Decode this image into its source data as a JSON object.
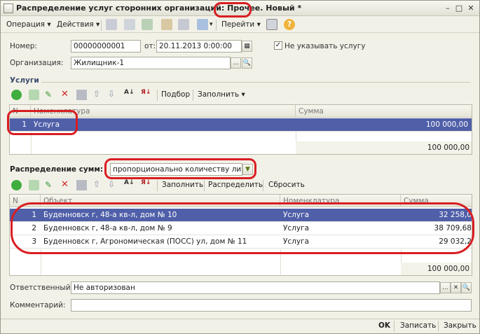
{
  "window": {
    "title": "Распределение услуг сторонних организаций: Прочее. Новый *"
  },
  "toolbar": {
    "operation": "Операция",
    "actions": "Действия",
    "goto": "Перейти",
    "help": "?"
  },
  "form": {
    "number_label": "Номер:",
    "number_value": "00000000001",
    "from_label": "от:",
    "date_value": "20.11.2013  0:00:00",
    "checkbox_label": "Не указывать услугу",
    "org_label": "Организация:",
    "org_value": "Жилищник-1"
  },
  "services": {
    "title": "Услуги",
    "pick_label": "Подбор",
    "fill_label": "Заполнить",
    "columns": [
      "N",
      "Номенклатура",
      "Сумма"
    ],
    "rows": [
      {
        "n": "1",
        "name": "Услуга",
        "sum": "100 000,00"
      }
    ],
    "total": "100 000,00"
  },
  "distribution": {
    "label": "Распределение сумм:",
    "method": "пропорционально количеству лицевых",
    "fill_label": "Заполнить",
    "distribute_label": "Распределить",
    "reset_label": "Сбросить",
    "columns": [
      "N",
      "Объект",
      "Номенклатура",
      "Сумма"
    ],
    "rows": [
      {
        "n": "1",
        "object": "Буденновск г, 48-а кв-л, дом № 10",
        "nom": "Услуга",
        "sum": "32 258,0"
      },
      {
        "n": "2",
        "object": "Буденновск г, 48-а кв-л, дом № 9",
        "nom": "Услуга",
        "sum": "38 709,68"
      },
      {
        "n": "3",
        "object": "Буденновск г, Агрономическая (ПОСС) ул, дом № 11",
        "nom": "Услуга",
        "sum": "29 032,2"
      }
    ],
    "total": "100 000,00"
  },
  "footer": {
    "responsible_label": "Ответственный:",
    "responsible_value": "Не авторизован",
    "comment_label": "Комментарий:",
    "comment_value": "",
    "ok": "OK",
    "save": "Записать",
    "close": "Закрыть"
  }
}
